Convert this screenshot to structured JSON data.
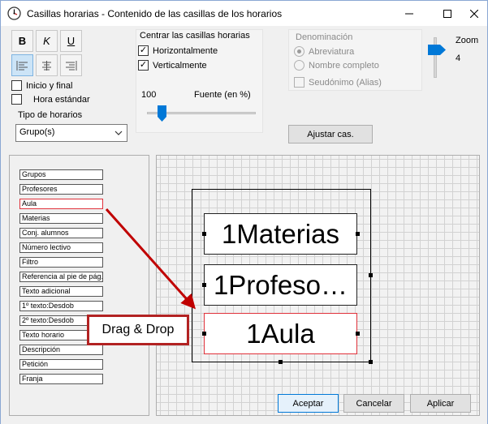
{
  "window": {
    "title": "Casillas horarias - Contenido de las casillas de los horarios"
  },
  "toolbar": {
    "bold": "B",
    "italic": "K",
    "underline": "U"
  },
  "left_options": {
    "inicio_final": "Inicio y final",
    "hora_estandar": "Hora estándar",
    "tipo_horarios_label": "Tipo de horarios",
    "tipo_horarios_value": "Grupo(s)"
  },
  "centrar": {
    "title": "Centrar las casillas horarias",
    "horizontal": "Horizontalmente",
    "vertical": "Verticalmente"
  },
  "font": {
    "percent_value": "100",
    "label": "Fuente (en %)"
  },
  "denominacion": {
    "title": "Denominación",
    "abreviatura": "Abreviatura",
    "nombre_completo": "Nombre completo",
    "seudonimo": "Seudónimo (Alias)"
  },
  "zoom": {
    "label": "Zoom",
    "value": "4"
  },
  "ajustar_button": "Ajustar cas.",
  "fields": [
    "Grupos",
    "Profesores",
    "Aula",
    "Materias",
    "Conj. alumnos",
    "Número lectivo",
    "Filtro",
    "Referencia al pie de pág.",
    "Texto adicional",
    "1º texto:Desdob",
    "2º texto:Desdob",
    "Texto horario",
    "Descripción",
    "Petición",
    "Franja"
  ],
  "cells": [
    "1Materias",
    "1Profeso…",
    "1Aula"
  ],
  "callout": "Drag & Drop",
  "footer": {
    "accept": "Aceptar",
    "cancel": "Cancelar",
    "apply": "Aplicar"
  },
  "colors": {
    "accent_blue": "#0078d7",
    "highlight_red": "#e0313a",
    "arrow_red": "#c00000"
  }
}
